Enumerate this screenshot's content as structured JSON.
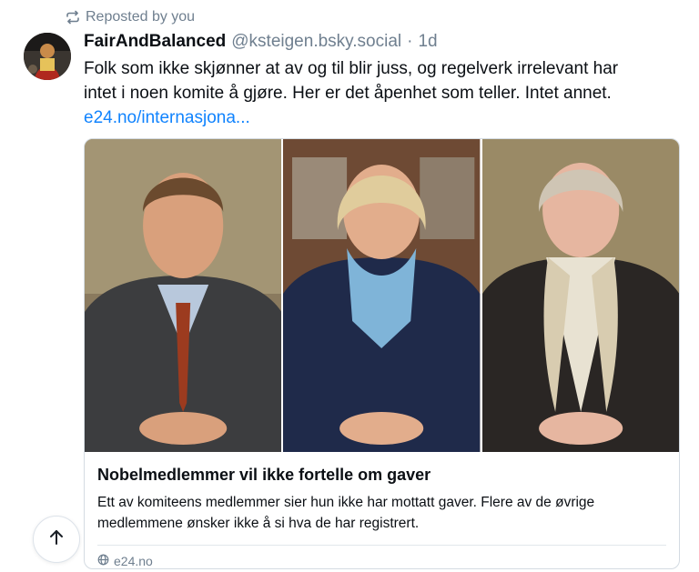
{
  "repost": {
    "label": "Reposted by you",
    "icon": "repost-icon"
  },
  "post": {
    "author": "FairAndBalanced",
    "handle": "@ksteigen.bsky.social",
    "separator": "·",
    "age": "1d",
    "text_line1": "Folk som ikke skjønner at av og til blir juss, og regelverk irrelevant har",
    "text_line2": "intet i noen komite å gjøre. Her er det åpenhet som teller. Intet annet.",
    "link": "e24.no/internasjona..."
  },
  "card": {
    "title": "Nobelmedlemmer vil ikke fortelle om gaver",
    "description_line1": "Ett av komiteens medlemmer sier hun ikke har mottatt gaver. Flere av de øvrige",
    "description_line2": "medlemmene ønsker ikke å si hva de har registrert.",
    "source": "e24.no",
    "source_icon": "globe-icon"
  },
  "colors": {
    "link": "#1083fe",
    "muted": "#6f7f8f",
    "text": "#0b0f14",
    "border": "#d4dbe2"
  },
  "scroll_top_icon": "arrow-up-icon"
}
